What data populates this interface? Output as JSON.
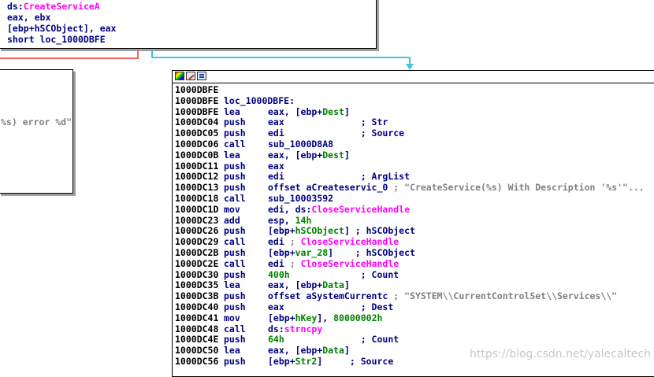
{
  "colors": {
    "instruction": "#000080",
    "import": "#ff00ff",
    "variable": "#008000",
    "comment": "#808080",
    "edge_true": "#3ec8d8",
    "edge_false": "#ff6060"
  },
  "top_node": {
    "lines": [
      "ds:CreateServiceA",
      "eax, ebx",
      "[ebp+hSCObject], eax",
      "short loc_1000DBFE"
    ]
  },
  "left_node": {
    "text": "%s) error %d\""
  },
  "main_node": {
    "header_icons": [
      "palette-icon",
      "edit-icon",
      "graph-icon"
    ],
    "lines": [
      {
        "addr": "1000DBFE",
        "mnem": "",
        "ops": []
      },
      {
        "addr": "1000DBFE",
        "mnem": "loc_1000DBFE:",
        "ops": []
      },
      {
        "addr": "1000DBFE",
        "mnem": "lea",
        "ops": [
          {
            "t": "op",
            "v": "eax, [ebp+"
          },
          {
            "t": "var",
            "v": "Dest"
          },
          {
            "t": "op",
            "v": "]"
          }
        ]
      },
      {
        "addr": "1000DC04",
        "mnem": "push",
        "ops": [
          {
            "t": "op",
            "v": "eax              ; Str"
          }
        ]
      },
      {
        "addr": "1000DC05",
        "mnem": "push",
        "ops": [
          {
            "t": "op",
            "v": "edi              ; Source"
          }
        ]
      },
      {
        "addr": "1000DC06",
        "mnem": "call",
        "ops": [
          {
            "t": "op",
            "v": "sub_1000D8A8"
          }
        ]
      },
      {
        "addr": "1000DC0B",
        "mnem": "lea",
        "ops": [
          {
            "t": "op",
            "v": "eax, [ebp+"
          },
          {
            "t": "var",
            "v": "Dest"
          },
          {
            "t": "op",
            "v": "]"
          }
        ]
      },
      {
        "addr": "1000DC11",
        "mnem": "push",
        "ops": [
          {
            "t": "op",
            "v": "eax"
          }
        ]
      },
      {
        "addr": "1000DC12",
        "mnem": "push",
        "ops": [
          {
            "t": "op",
            "v": "edi              ; ArgList"
          }
        ]
      },
      {
        "addr": "1000DC13",
        "mnem": "push",
        "ops": [
          {
            "t": "op",
            "v": "offset aCreateservic_0 "
          },
          {
            "t": "cmt",
            "v": "; \"CreateService(%s) With Description '%s'\"..."
          }
        ]
      },
      {
        "addr": "1000DC18",
        "mnem": "call",
        "ops": [
          {
            "t": "op",
            "v": "sub_10003592"
          }
        ]
      },
      {
        "addr": "1000DC1D",
        "mnem": "mov",
        "ops": [
          {
            "t": "op",
            "v": "edi, ds:"
          },
          {
            "t": "imp",
            "v": "CloseServiceHandle"
          }
        ]
      },
      {
        "addr": "1000DC23",
        "mnem": "add",
        "ops": [
          {
            "t": "op",
            "v": "esp, "
          },
          {
            "t": "num",
            "v": "14h"
          }
        ]
      },
      {
        "addr": "1000DC26",
        "mnem": "push",
        "ops": [
          {
            "t": "op",
            "v": "[ebp+"
          },
          {
            "t": "var",
            "v": "hSCObject"
          },
          {
            "t": "op",
            "v": "] ; hSCObject"
          }
        ]
      },
      {
        "addr": "1000DC29",
        "mnem": "call",
        "ops": [
          {
            "t": "op",
            "v": "edi "
          },
          {
            "t": "cmt",
            "v": "; "
          },
          {
            "t": "imp",
            "v": "CloseServiceHandle"
          }
        ]
      },
      {
        "addr": "1000DC2B",
        "mnem": "push",
        "ops": [
          {
            "t": "op",
            "v": "[ebp+"
          },
          {
            "t": "var",
            "v": "var_28"
          },
          {
            "t": "op",
            "v": "]    ; hSCObject"
          }
        ]
      },
      {
        "addr": "1000DC2E",
        "mnem": "call",
        "ops": [
          {
            "t": "op",
            "v": "edi "
          },
          {
            "t": "cmt",
            "v": "; "
          },
          {
            "t": "imp",
            "v": "CloseServiceHandle"
          }
        ]
      },
      {
        "addr": "1000DC30",
        "mnem": "push",
        "ops": [
          {
            "t": "num",
            "v": "400h"
          },
          {
            "t": "op",
            "v": "             ; Count"
          }
        ]
      },
      {
        "addr": "1000DC35",
        "mnem": "lea",
        "ops": [
          {
            "t": "op",
            "v": "eax, [ebp+"
          },
          {
            "t": "var",
            "v": "Data"
          },
          {
            "t": "op",
            "v": "]"
          }
        ]
      },
      {
        "addr": "1000DC3B",
        "mnem": "push",
        "ops": [
          {
            "t": "op",
            "v": "offset aSystemCurrentc "
          },
          {
            "t": "cmt",
            "v": "; \"SYSTEM\\\\CurrentControlSet\\\\Services\\\\\""
          }
        ]
      },
      {
        "addr": "1000DC40",
        "mnem": "push",
        "ops": [
          {
            "t": "op",
            "v": "eax              ; Dest"
          }
        ]
      },
      {
        "addr": "1000DC41",
        "mnem": "mov",
        "ops": [
          {
            "t": "op",
            "v": "[ebp+"
          },
          {
            "t": "var",
            "v": "hKey"
          },
          {
            "t": "op",
            "v": "], "
          },
          {
            "t": "num",
            "v": "80000002h"
          }
        ]
      },
      {
        "addr": "1000DC48",
        "mnem": "call",
        "ops": [
          {
            "t": "op",
            "v": "ds:"
          },
          {
            "t": "imp",
            "v": "strncpy"
          }
        ]
      },
      {
        "addr": "1000DC4E",
        "mnem": "push",
        "ops": [
          {
            "t": "num",
            "v": "64h"
          },
          {
            "t": "op",
            "v": "              ; Count"
          }
        ]
      },
      {
        "addr": "1000DC50",
        "mnem": "lea",
        "ops": [
          {
            "t": "op",
            "v": "eax, [ebp+"
          },
          {
            "t": "var",
            "v": "Data"
          },
          {
            "t": "op",
            "v": "]"
          }
        ]
      },
      {
        "addr": "1000DC56",
        "mnem": "push",
        "ops": [
          {
            "t": "op",
            "v": "[ebp+"
          },
          {
            "t": "var",
            "v": "Str2"
          },
          {
            "t": "op",
            "v": "]     ; Source"
          }
        ]
      }
    ]
  },
  "watermark": "https://blog.csdn.net/yalecaltech"
}
